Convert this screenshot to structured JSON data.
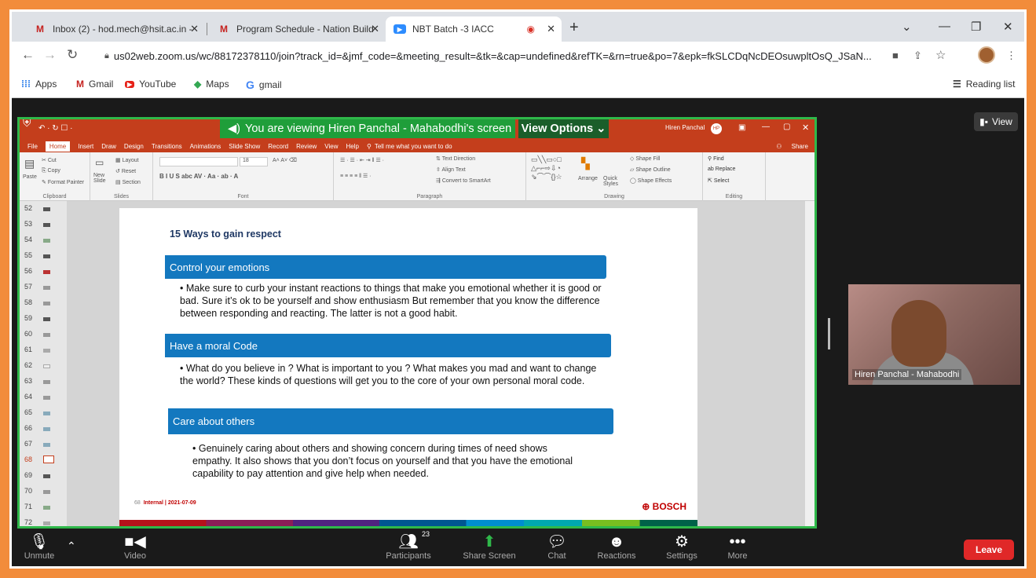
{
  "browser": {
    "tabs": [
      {
        "title": "Inbox (2) - hod.mech@hsit.ac.in - ",
        "icon": "gmail-icon",
        "fav": "M"
      },
      {
        "title": "Program Schedule - Nation Build",
        "icon": "gmail-icon",
        "fav": "M"
      },
      {
        "title": "NBT Batch -3 IACC",
        "icon": "zoom-icon",
        "fav": "▶"
      }
    ],
    "url": "us02web.zoom.us/wc/88172378110/join?track_id=&jmf_code=&meeting_result=&tk=&cap=undefined&refTK=&rn=true&po=7&epk=fkSLCDqNcDEOsuwpltOsQ_JSaN...",
    "bookmarks": [
      "Apps",
      "Gmail",
      "YouTube",
      "Maps",
      "gmail"
    ],
    "reading_list": "Reading list"
  },
  "zoom": {
    "banner": "You are viewing Hiren Panchal - Mahabodhi's screen",
    "view_options": "View Options",
    "view_button": "View",
    "participant_name": "Hiren Panchal - Mahabodhi",
    "participants_count": "23",
    "toolbar": {
      "unmute": "Unmute",
      "video": "Video",
      "participants": "Participants",
      "share": "Share Screen",
      "chat": "Chat",
      "reactions": "Reactions",
      "settings": "Settings",
      "more": "More",
      "leave": "Leave"
    }
  },
  "ppt": {
    "user": "Hiren Panchal",
    "user_initials": "HP",
    "share_label": "Share",
    "menu": [
      "File",
      "Home",
      "Insert",
      "Draw",
      "Design",
      "Transitions",
      "Animations",
      "Slide Show",
      "Record",
      "Review",
      "View",
      "Help",
      "Tell me what you want to do"
    ],
    "groups": [
      "Clipboard",
      "Slides",
      "Font",
      "Paragraph",
      "Drawing",
      "Editing"
    ],
    "ribbon_items": {
      "cut": "Cut",
      "copy": "Copy",
      "format_painter": "Format Painter",
      "paste": "Paste",
      "new_slide": "New Slide",
      "layout": "Layout",
      "reset": "Reset",
      "section": "Section",
      "text_direction": "Text Direction",
      "align_text": "Align Text",
      "convert": "Convert to SmartArt",
      "arrange": "Arrange",
      "quick_styles": "Quick Styles",
      "shape_fill": "Shape Fill",
      "shape_outline": "Shape Outline",
      "shape_effects": "Shape Effects",
      "find": "Find",
      "replace": "Replace",
      "select": "Select",
      "font_size": "18"
    },
    "slide_numbers": [
      "52",
      "53",
      "54",
      "55",
      "56",
      "57",
      "58",
      "59",
      "60",
      "61",
      "62",
      "63",
      "64",
      "65",
      "66",
      "67",
      "68",
      "69",
      "70",
      "71",
      "72"
    ],
    "slide": {
      "title": "15 Ways to gain respect",
      "sections": [
        {
          "heading": "Control your emotions",
          "text": "• Make sure to curb your instant reactions to things that make you emotional whether it is good or bad. Sure it’s ok to be yourself and show enthusiasm But remember that you know the difference between responding and reacting. The latter is not a good habit."
        },
        {
          "heading": "Have a moral Code",
          "text": "• What do you believe in ? What is important to you ? What makes you mad and want to change the world? These kinds of questions will get you to the core of your own personal moral code."
        },
        {
          "heading": "Care about others",
          "text": "• Genuinely caring about others and showing concern during times of need shows empathy. It also shows that you don’t focus on yourself and that you have the emotional capability to pay attention and give help when needed."
        }
      ],
      "page_number": "68",
      "footer": "Internal | 2021-07-09",
      "brand": "BOSCH"
    }
  },
  "colors": {
    "orange_border": "#f28c3b",
    "zoom_green": "#2fb84a",
    "ppt_red": "#c43e1c",
    "slide_blue": "#1378bf",
    "leave_red": "#e02828"
  }
}
